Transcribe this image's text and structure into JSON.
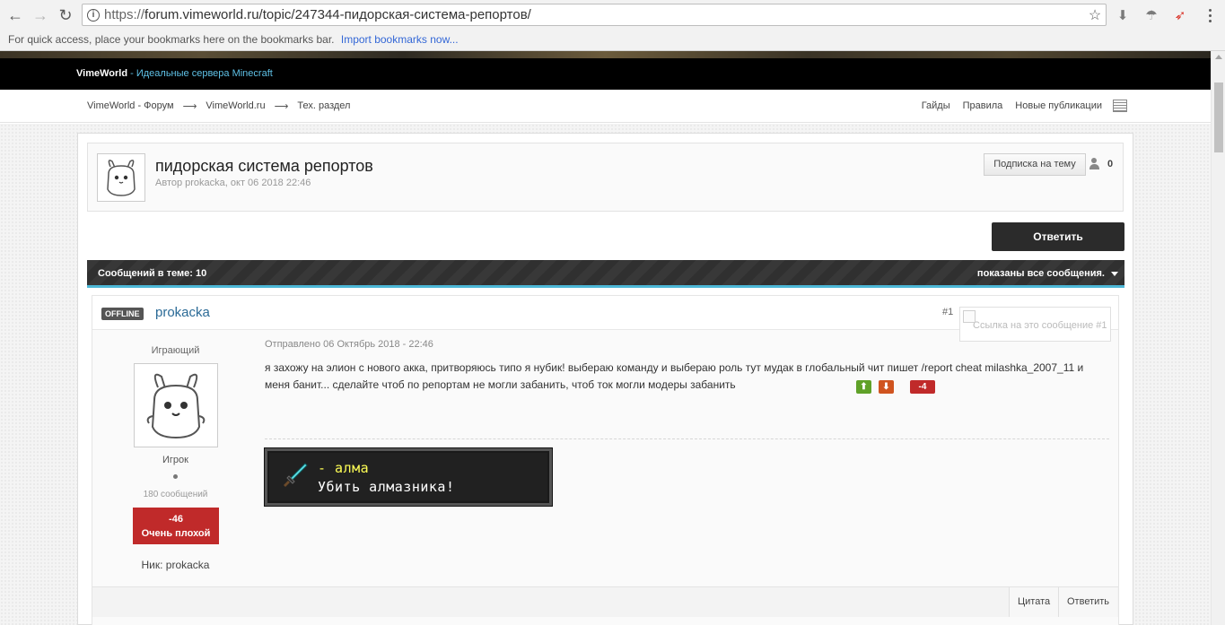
{
  "browser": {
    "url_proto": "https://",
    "url_rest": "forum.vimeworld.ru/topic/247344-пидорская-система-репортов/",
    "bookmarks_text": "For quick access, place your bookmarks here on the bookmarks bar.",
    "bookmarks_link": "Import bookmarks now..."
  },
  "site": {
    "brand": "VimeWorld",
    "tagline": " - Идеальные сервера Minecraft",
    "breadcrumbs": [
      "VimeWorld - Форум",
      "VimeWorld.ru",
      "Тех. раздел"
    ],
    "nav_links": [
      "Гайды",
      "Правила",
      "Новые публикации"
    ]
  },
  "topic": {
    "title": "пидорская система репортов",
    "meta": "Автор prokacka, окт 06 2018 22:46",
    "follow_label": "Подписка на тему",
    "followers": "0",
    "reply_label": "Ответить"
  },
  "bar": {
    "count_label": "Сообщений в теме: 10",
    "filter_label": "показаны все сообщения."
  },
  "post": {
    "status": "OFFLINE",
    "author": "prokacka",
    "number": "#1",
    "share_alt": "Ссылка на это сообщение #1",
    "rank": "Играющий",
    "group": "Игрок",
    "post_count": "180 сообщений",
    "rep_value": "-46",
    "rep_label": "Очень плохой",
    "nick": "Ник: prokacka",
    "posted": "Отправлено 06 Октябрь 2018 - 22:46",
    "text": "я захожу на элион с нового акка, притворяюсь типо я нубик! выбераю команду и выбераю роль тут мудак в глобальный чит пишет /report cheat milashka_2007_11 и меня банит... сделайте чтоб по репортам не могли забанить, чтоб ток могли модеры забанить",
    "post_rep": "-4",
    "achievement_title": "- алма",
    "achievement_desc": "Убить алмазника!",
    "quote_label": "Цитата",
    "reply_label": "Ответить"
  }
}
